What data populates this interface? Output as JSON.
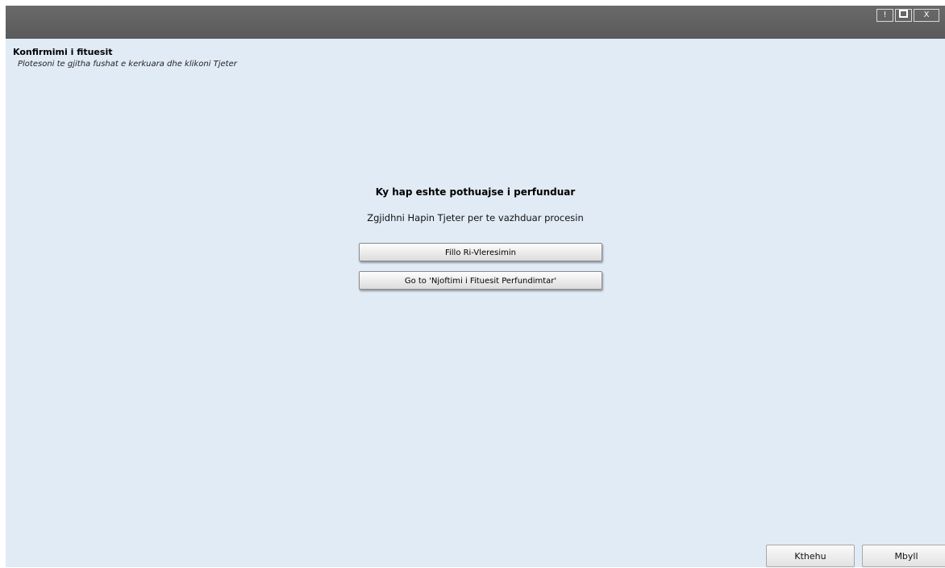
{
  "window": {
    "controls": {
      "alert": "!",
      "close": "X"
    }
  },
  "header": {
    "title": "Konfirmimi i fituesit",
    "subtitle": "Plotesoni te gjitha fushat e kerkuara dhe klikoni Tjeter"
  },
  "main": {
    "heading": "Ky hap eshte pothuajse i perfunduar",
    "instruction": "Zgjidhni Hapin Tjeter per te vazhduar procesin",
    "buttons": [
      "Fillo Ri-Vleresimin",
      "Go to 'Njoftimi i Fituesit Perfundimtar'"
    ]
  },
  "footer": {
    "back_label": "Kthehu",
    "close_label": "Mbyll"
  }
}
